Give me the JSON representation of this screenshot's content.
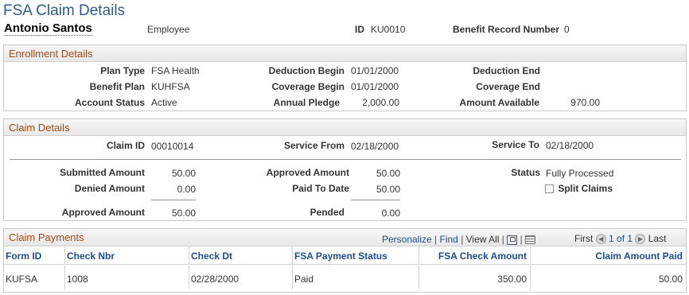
{
  "page": {
    "title": "FSA Claim Details",
    "employee_name": "Antonio Santos",
    "employee_role": "Employee",
    "id_label": "ID",
    "id_value": "KU0010",
    "benefit_record_label": "Benefit Record Number",
    "benefit_record_value": "0"
  },
  "enrollment": {
    "header": "Enrollment Details",
    "plan_type_label": "Plan Type",
    "plan_type": "FSA Health",
    "benefit_plan_label": "Benefit Plan",
    "benefit_plan": "KUHFSA",
    "account_status_label": "Account Status",
    "account_status": "Active",
    "deduction_begin_label": "Deduction Begin",
    "deduction_begin": "01/01/2000",
    "coverage_begin_label": "Coverage Begin",
    "coverage_begin": "01/01/2000",
    "annual_pledge_label": "Annual Pledge",
    "annual_pledge": "2,000.00",
    "deduction_end_label": "Deduction End",
    "deduction_end": "",
    "coverage_end_label": "Coverage End",
    "coverage_end": "",
    "amount_available_label": "Amount Available",
    "amount_available": "970.00"
  },
  "claim": {
    "header": "Claim Details",
    "claim_id_label": "Claim ID",
    "claim_id": "00010014",
    "service_from_label": "Service From",
    "service_from": "02/18/2000",
    "service_to_label": "Service To",
    "service_to": "02/18/2000",
    "submitted_amount_label": "Submitted Amount",
    "submitted_amount": "50.00",
    "denied_amount_label": "Denied Amount",
    "denied_amount": "0.00",
    "approved_amount_left_label": "Approved Amount",
    "approved_amount_left": "50.00",
    "approved_amount_mid_label": "Approved Amount",
    "approved_amount_mid": "50.00",
    "paid_to_date_label": "Paid To Date",
    "paid_to_date": "50.00",
    "pended_label": "Pended",
    "pended": "0.00",
    "status_label": "Status",
    "status": "Fully Processed",
    "split_claims_label": "Split Claims"
  },
  "payments": {
    "header": "Claim Payments",
    "personalize": "Personalize",
    "find": "Find",
    "view_all": "View All",
    "first": "First",
    "range": "1 of 1",
    "last": "Last",
    "columns": [
      "Form ID",
      "Check Nbr",
      "Check Dt",
      "FSA Payment Status",
      "FSA Check Amount",
      "Claim Amount Paid"
    ],
    "rows": [
      [
        "KUFSA",
        "1008",
        "02/28/2000",
        "Paid",
        "350.00",
        "50.00"
      ]
    ]
  }
}
